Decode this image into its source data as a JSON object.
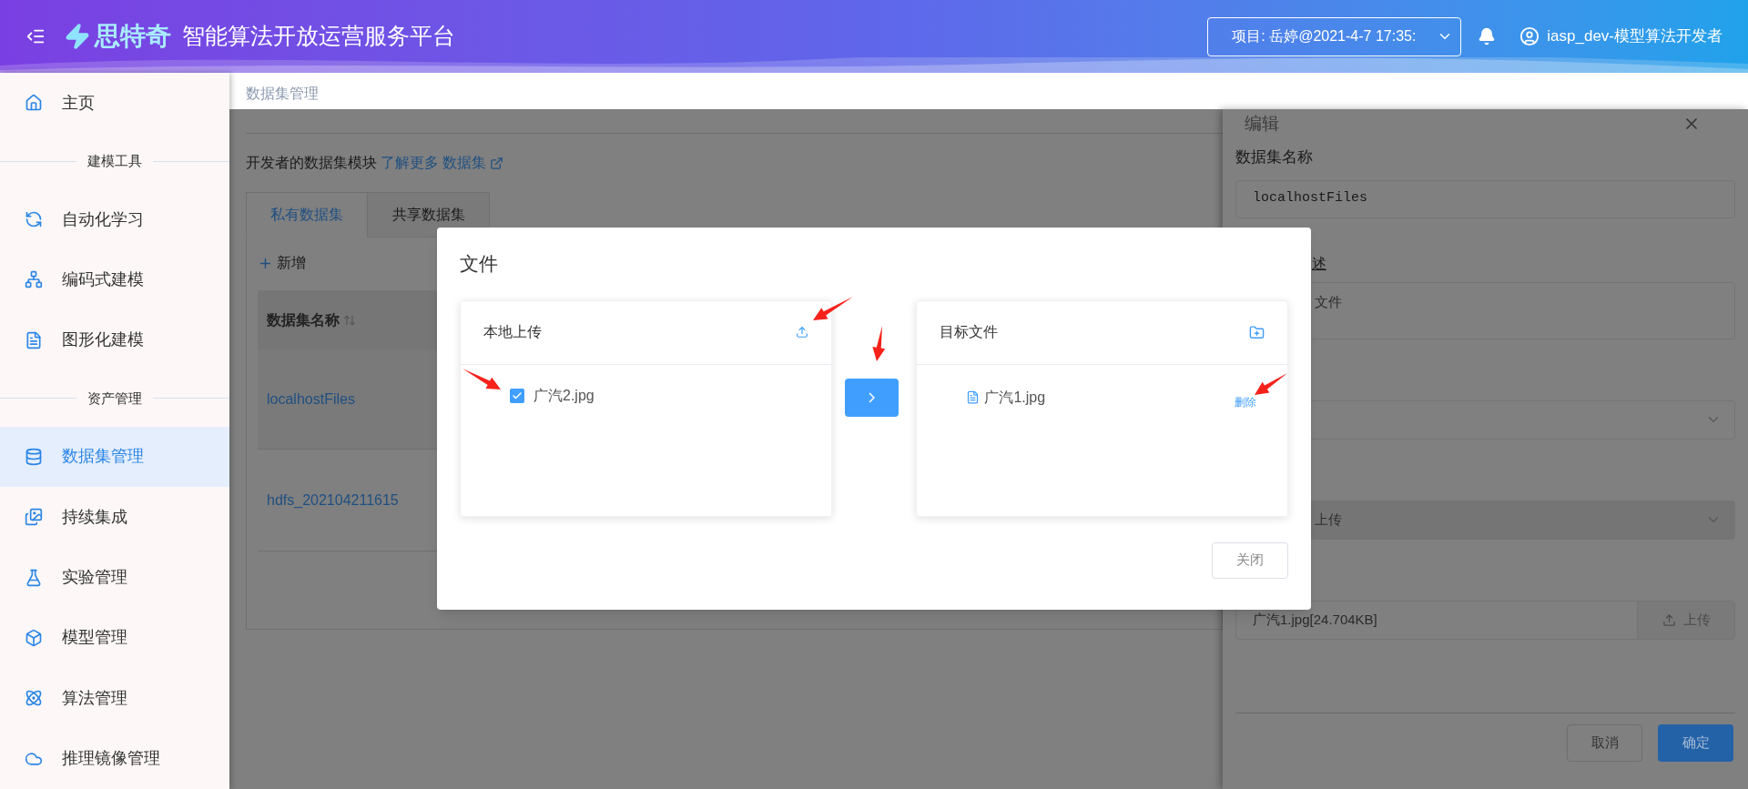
{
  "header": {
    "logo_text": "思特奇",
    "title": "智能算法开放运营服务平台",
    "project_select": "项目: 岳婷@2021-4-7 17:35:",
    "user": "iasp_dev-模型算法开发者"
  },
  "sidebar": {
    "items": [
      {
        "kind": "item",
        "label": "主页",
        "selected": false
      },
      {
        "kind": "section",
        "label": "建模工具"
      },
      {
        "kind": "item",
        "label": "自动化学习",
        "selected": false
      },
      {
        "kind": "item",
        "label": "编码式建模",
        "selected": false
      },
      {
        "kind": "item",
        "label": "图形化建模",
        "selected": false
      },
      {
        "kind": "section",
        "label": "资产管理"
      },
      {
        "kind": "item",
        "label": "数据集管理",
        "selected": true
      },
      {
        "kind": "item",
        "label": "持续集成",
        "selected": false
      },
      {
        "kind": "item",
        "label": "实验管理",
        "selected": false
      },
      {
        "kind": "item",
        "label": "模型管理",
        "selected": false
      },
      {
        "kind": "item",
        "label": "算法管理",
        "selected": false
      },
      {
        "kind": "item",
        "label": "推理镜像管理",
        "selected": false
      }
    ]
  },
  "breadcrumb": "数据集管理",
  "page": {
    "intro": "开发者的数据集模块",
    "link": "了解更多 数据集",
    "tabs": [
      {
        "label": "私有数据集",
        "selected": true
      },
      {
        "label": "共享数据集",
        "selected": false
      }
    ],
    "add_button": "新增",
    "table": {
      "columns": [
        "数据集名称"
      ],
      "rows": [
        [
          "localhostFiles"
        ],
        [
          "hdfs_202104211615"
        ]
      ]
    }
  },
  "drawer": {
    "title": "编辑",
    "fields": [
      {
        "kind": "input",
        "label": "数据集名称",
        "value": "localhostFiles"
      },
      {
        "kind": "textarea",
        "label": "述",
        "value": "文件"
      },
      {
        "kind": "select"
      },
      {
        "kind": "select",
        "value": "上传",
        "disabled": true
      },
      {
        "kind": "upload",
        "value": "广汽1.jpg[24.704KB]",
        "button": "上传"
      }
    ],
    "cancel_button": "取消",
    "ok_button": "确定"
  },
  "modal": {
    "title": "文件",
    "source": {
      "title": "本地上传",
      "files": [
        {
          "name": "广汽2.jpg",
          "checked": true
        }
      ]
    },
    "target": {
      "title": "目标文件",
      "files": [
        {
          "name": "广汽1.jpg",
          "action": "删除"
        }
      ]
    },
    "close_button": "关闭"
  }
}
